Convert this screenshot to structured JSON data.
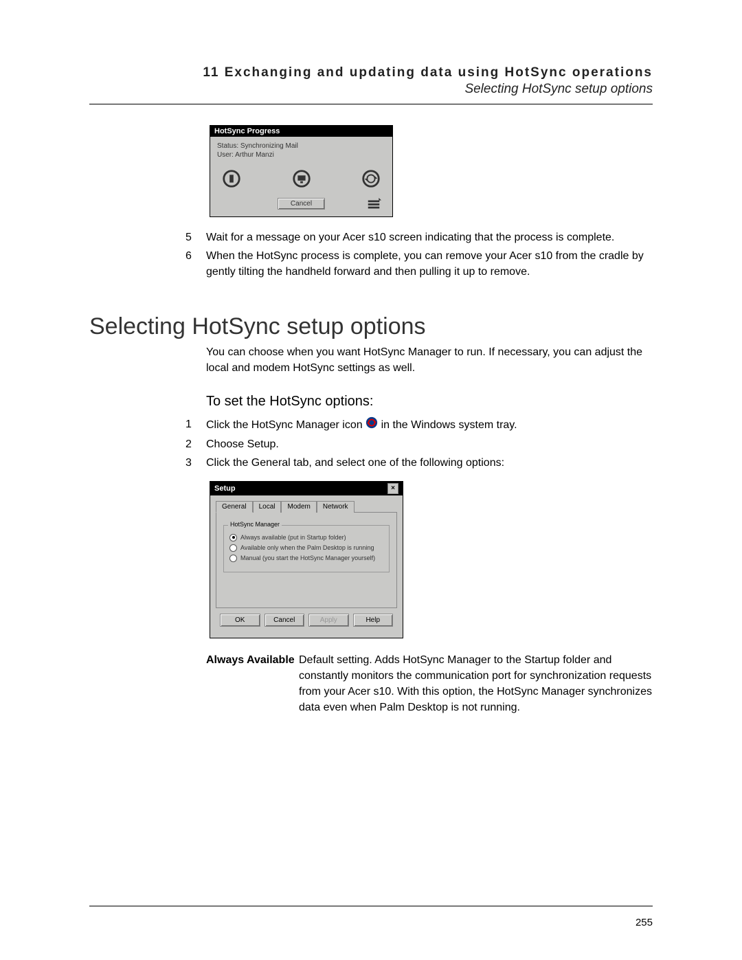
{
  "header": {
    "chapter": "11 Exchanging and updating data using HotSync operations",
    "section": "Selecting HotSync setup options"
  },
  "hotsync_progress": {
    "title": "HotSync Progress",
    "status_label": "Status:",
    "status_value": "Synchronizing Mail",
    "user_label": "User:",
    "user_value": "Arthur Manzi",
    "cancel": "Cancel"
  },
  "steps_a": [
    {
      "n": "5",
      "t": "Wait for a message on your Acer s10 screen indicating that the process is complete."
    },
    {
      "n": "6",
      "t": "When the HotSync process is complete, you can remove your Acer s10 from the cradle by gently tilting the handheld forward and then pulling it up to remove."
    }
  ],
  "heading": "Selecting HotSync setup options",
  "intro": "You can choose when you want HotSync Manager to run. If necessary, you can adjust the local and modem HotSync settings as well.",
  "subheading": "To set the HotSync options:",
  "steps_b": [
    {
      "n": "1",
      "pre": "Click the HotSync Manager icon ",
      "post": " in the Windows system tray."
    },
    {
      "n": "2",
      "t": "Choose Setup."
    },
    {
      "n": "3",
      "t": "Click the General tab, and select one of the following options:"
    }
  ],
  "setup": {
    "title": "Setup",
    "tabs": [
      "General",
      "Local",
      "Modem",
      "Network"
    ],
    "group": "HotSync Manager",
    "options": [
      {
        "checked": true,
        "label": "Always available (put in Startup folder)"
      },
      {
        "checked": false,
        "label": "Available only when the Palm Desktop is running"
      },
      {
        "checked": false,
        "label": "Manual (you start the HotSync Manager yourself)"
      }
    ],
    "buttons": {
      "ok": "OK",
      "cancel": "Cancel",
      "apply": "Apply",
      "help": "Help"
    }
  },
  "option_desc": {
    "label": "Always Available",
    "text": "Default setting. Adds HotSync Manager to the Startup folder and constantly monitors the communication port for synchronization requests from your Acer s10. With this option, the HotSync Manager synchronizes data even when Palm Desktop is not running."
  },
  "page_number": "255"
}
